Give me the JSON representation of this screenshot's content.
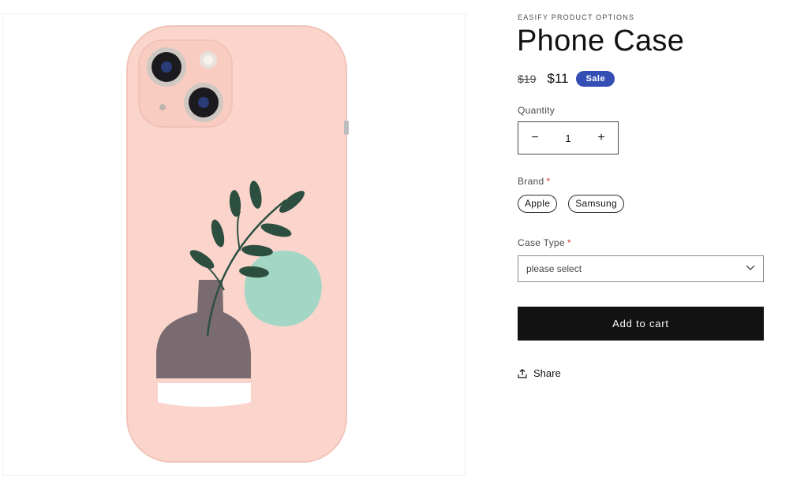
{
  "product": {
    "vendor": "EASIFY PRODUCT OPTIONS",
    "title": "Phone Case",
    "price_compare": "$19",
    "price_sale": "$11",
    "sale_badge": "Sale",
    "image_alt": "pink phone case with plant vase illustration"
  },
  "quantity": {
    "label": "Quantity",
    "value": "1",
    "decrease": "−",
    "increase": "+"
  },
  "brand": {
    "label": "Brand",
    "required_mark": "*",
    "options": [
      "Apple",
      "Samsung"
    ]
  },
  "case_type": {
    "label": "Case Type",
    "required_mark": "*",
    "placeholder": "please select"
  },
  "actions": {
    "add_to_cart": "Add to cart",
    "share": "Share"
  },
  "colors": {
    "accent": "#334fb4",
    "button": "#121212",
    "required": "#d8392c",
    "case": "#fbd5cc"
  }
}
